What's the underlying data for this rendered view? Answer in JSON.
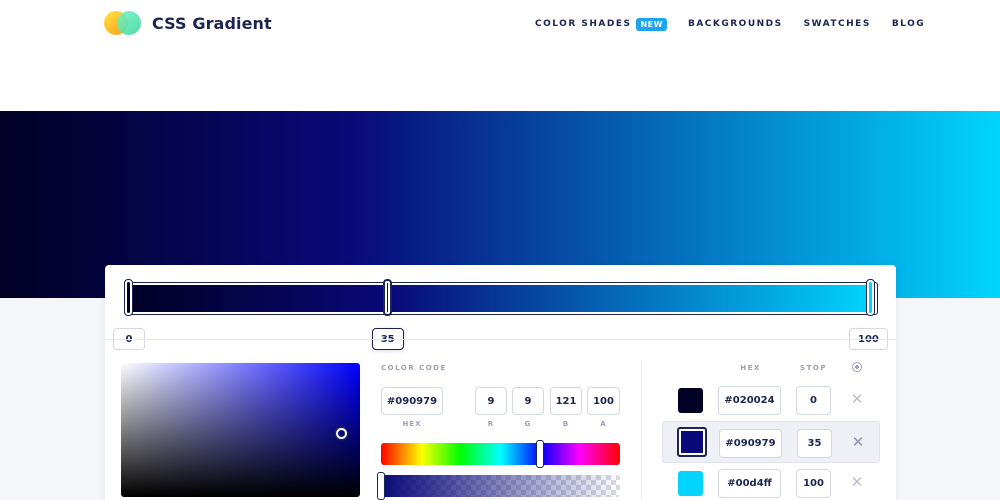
{
  "brand": {
    "name": "CSS Gradient"
  },
  "nav": {
    "items": [
      {
        "label": "COLOR SHADES",
        "badge": "NEW"
      },
      {
        "label": "BACKGROUNDS"
      },
      {
        "label": "SWATCHES"
      },
      {
        "label": "BLOG"
      }
    ]
  },
  "gradient": {
    "type": "linear",
    "direction": "to right",
    "stops": [
      {
        "hex": "#020024",
        "position": 0
      },
      {
        "hex": "#090979",
        "position": 35
      },
      {
        "hex": "#00d4ff",
        "position": 100
      }
    ],
    "selected_stop_index": 1
  },
  "editor": {
    "stop_labels": [
      "0",
      "35",
      "100"
    ],
    "color_code_label": "COLOR CODE",
    "hex_value": "#090979",
    "r": "9",
    "g": "9",
    "b": "121",
    "a": "100",
    "labels": {
      "hex": "HEX",
      "r": "R",
      "g": "G",
      "b": "B",
      "a": "A"
    }
  },
  "stop_list": {
    "header_hex": "HEX",
    "header_stop": "STOP",
    "add_icon": "plus-circle-icon",
    "remove_icon": "close-icon",
    "remove_glyph": "✕",
    "rows": [
      {
        "hex": "#020024",
        "stop": "0"
      },
      {
        "hex": "#090979",
        "stop": "35"
      },
      {
        "hex": "#00d4ff",
        "stop": "100"
      }
    ]
  },
  "colors": {
    "brand_text": "#1c2450",
    "badge": "#1aa4f2",
    "muted": "#9aa1b6"
  }
}
